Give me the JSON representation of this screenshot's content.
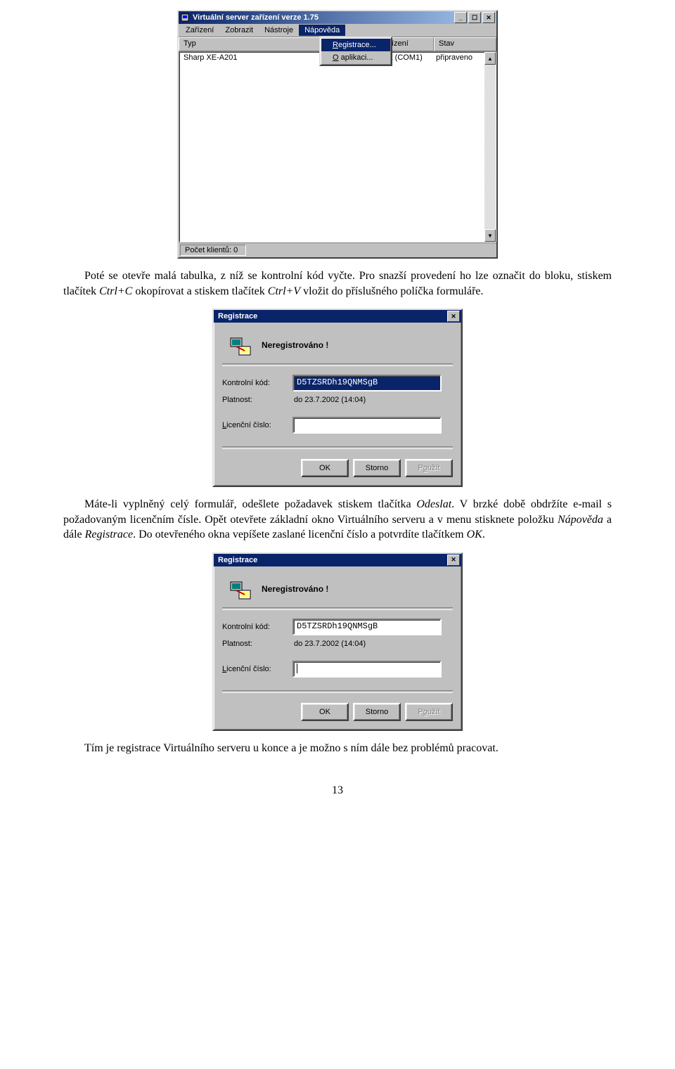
{
  "mainwin": {
    "title": "Virtuální server zařízení  verze 1.75",
    "menus": [
      "Zařízení",
      "Zobrazit",
      "Nástroje",
      "Nápověda"
    ],
    "dropdown": {
      "items": [
        "Registrace...",
        "O aplikaci..."
      ]
    },
    "columns": {
      "c1": "Typ",
      "c2": "Komunikační zařízení",
      "c3": "Stav"
    },
    "row": {
      "c1": "Sharp XE-A201",
      "c2": "Komunikační port (COM1)",
      "c3": "připraveno"
    },
    "status": "Počet klientů: 0"
  },
  "para1": {
    "a": "Poté se otevře malá tabulka, z níž se kontrolní kód vyčte. Pro snazší provedení ho lze označit do bloku, stiskem tlačítek ",
    "i1": "Ctrl+C",
    "b": " okopírovat a stiskem tlačítek ",
    "i2": "Ctrl+V",
    "c": " vložit do příslušného políčka formuláře."
  },
  "dlg": {
    "title": "Registrace",
    "status": "Neregistrováno !",
    "labels": {
      "kontrolni": "Kontrolní kód:",
      "platnost": "Platnost:",
      "licencni_html": "<u>L</u>icenční číslo:"
    },
    "kod": "D5TZSRDh19QNMSgB",
    "platnost": "do 23.7.2002 (14:04)",
    "buttons": {
      "ok": "OK",
      "storno": "Storno",
      "pouzit_html": "P<u>o</u>užít"
    }
  },
  "para2": {
    "a": "Máte-li vyplněný celý formulář, odešlete požadavek stiskem tlačítka ",
    "i1": "Odeslat",
    "b": ". V brzké době obdržíte e-mail s požadovaným licenčním čísle. Opět otevřete základní okno Virtuálního serveru a v menu stisknete položku ",
    "i2": "Nápověda",
    "c": " a dále ",
    "i3": "Registrace",
    "d": ". Do otevřeného okna vepíšete zaslané licenční číslo a potvrdíte tlačítkem ",
    "i4": "OK",
    "e": "."
  },
  "para3": "Tím je registrace Virtuálního serveru u konce a je možno s ním dále bez problémů pracovat.",
  "page_number": "13"
}
